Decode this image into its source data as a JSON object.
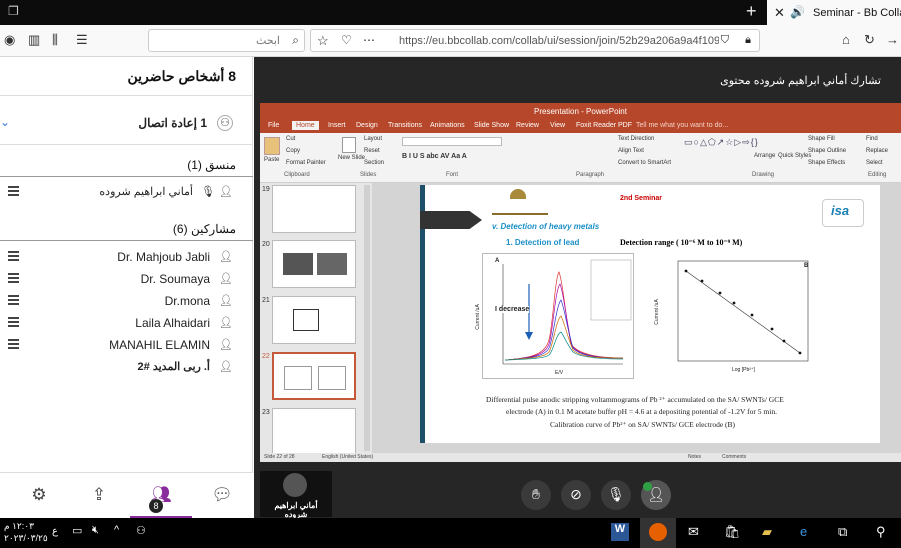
{
  "browser": {
    "tab_title": "Seminar - Bb Collabor",
    "new_tab_label": "+",
    "search_placeholder": "ابحث",
    "url": "https://eu.bbcollab.com/collab/ui/session/join/52b29a206a9a4f109"
  },
  "attendees": {
    "title": "8 أشخاص حاضرين",
    "reconnect": "1 إعادة اتصال",
    "coordinator_header": "منسق (1)",
    "coordinator": "أماني ابراهيم شروده",
    "participants_header": "مشاركين (6)",
    "participants": [
      "Dr. Mahjoub Jabli",
      "Dr. Soumaya",
      "Dr.mona",
      "Laila Alhaidari",
      "MANAHIL ELAMIN",
      "أ. ربى المديد #2"
    ],
    "badge_count": "8"
  },
  "presenter_label": "تشارك أماني ابراهيم شروده محتوى",
  "self_video_name": "أماني ابراهيم شروده",
  "powerpoint": {
    "title": "Presentation - PowerPoint",
    "tabs": [
      "File",
      "Home",
      "Insert",
      "Design",
      "Transitions",
      "Animations",
      "Slide Show",
      "Review",
      "View",
      "Foxit Reader PDF",
      "Tell me what you want to do..."
    ],
    "groups": [
      "Clipboard",
      "Slides",
      "Font",
      "Paragraph",
      "Drawing",
      "Editing"
    ],
    "ribbon_items": {
      "cut": "Cut",
      "copy": "Copy",
      "format_painter": "Format Painter",
      "paste": "Paste",
      "new_slide": "New Slide",
      "layout": "Layout",
      "reset": "Reset",
      "section": "Section",
      "text_direction": "Text Direction",
      "align_text": "Align Text",
      "smartart": "Convert to SmartArt",
      "arrange": "Arrange",
      "quick_styles": "Quick Styles",
      "shape_fill": "Shape Fill",
      "shape_outline": "Shape Outline",
      "shape_effects": "Shape Effects",
      "find": "Find",
      "replace": "Replace",
      "select": "Select"
    },
    "thumb_numbers": [
      "19",
      "20",
      "21",
      "22",
      "23"
    ],
    "status": "Slide 22 of 28",
    "language": "English (United States)",
    "notes": "Notes",
    "comments": "Comments"
  },
  "slide": {
    "seminar": "2nd Seminar",
    "section": "v.   Detection of heavy metals",
    "subsection": "1.   Detection of lead",
    "range": "Detection range ( 10⁻⁶ M to 10⁻⁹ M)",
    "panel_a": "A",
    "panel_b": "B",
    "arrow_label": "I decrease",
    "xlabel_a": "E/V",
    "ylabel_a": "Current /uA",
    "xlabel_b": "Log [Pb²⁺]",
    "ylabel_b": "Current /uA",
    "caption_1": "Differential pulse anodic stripping voltammograms of Pb ²⁺ accumulated on the SA/ SWNTs/ GCE",
    "caption_2": "electrode (A) in 0.1 M acetate buffer pH = 4.6 at a  depositing potential of -1.2V for 5 min.",
    "caption_3": "Calibration curve of Pb²⁺ on SA/ SWNTs/ GCE electrode (B)"
  },
  "taskbar": {
    "time": "١٢:٠٣ م",
    "date": "٢٠٢٣/٠٣/٢٥",
    "lang": "ع"
  }
}
